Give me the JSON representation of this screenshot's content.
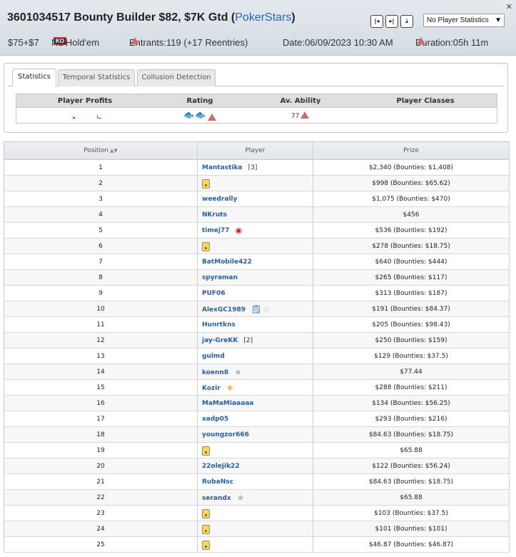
{
  "header": {
    "title_main": "3601034517 Bounty Builder $82, $7K Gtd (",
    "site": "PokerStars",
    "title_end": ")",
    "close": "✕",
    "nav": [
      "|◂",
      "▸|",
      "⤓"
    ],
    "stats_select": "No Player Statistics",
    "buyin": "$75+$7",
    "game": "NL Hold'em",
    "game_badge": "KO",
    "entrants": "Entrants:119 (+17 Reentries)",
    "date": "Date:06/09/2023 10:30 AM",
    "duration": "Duration:05h 11m"
  },
  "tabs": [
    "Statistics",
    "Temporal Statistics",
    "Collusion Detection"
  ],
  "stats": {
    "headers": [
      "Player Profits",
      "Rating",
      "Av. Ability",
      "Player Classes"
    ],
    "av_ability": "77",
    "colors": {
      "loss": "#dd3333",
      "profit": "#22aa22",
      "warning": "#d46a6a"
    }
  },
  "table": {
    "headers": [
      "Position",
      "Player",
      "Prize"
    ],
    "rows": [
      {
        "pos": "1",
        "player": "Mantastika",
        "extra": "[3]",
        "icon": "",
        "prize": "$2,340  (Bounties: $1,408)"
      },
      {
        "pos": "2",
        "player": "",
        "extra": "",
        "icon": "lock-icon",
        "prize": "$998  (Bounties: $65.62)"
      },
      {
        "pos": "3",
        "player": "weedrally",
        "extra": "",
        "icon": "",
        "prize": "$1,075  (Bounties: $470)"
      },
      {
        "pos": "4",
        "player": "NKruts",
        "extra": "",
        "icon": "",
        "prize": "$456"
      },
      {
        "pos": "5",
        "player": "timej77",
        "extra": "",
        "icon": "target-icon",
        "prize": "$536  (Bounties: $192)"
      },
      {
        "pos": "6",
        "player": "",
        "extra": "",
        "icon": "lock-icon",
        "prize": "$278  (Bounties: $18.75)"
      },
      {
        "pos": "7",
        "player": "BatMobile422",
        "extra": "",
        "icon": "",
        "prize": "$640  (Bounties: $444)"
      },
      {
        "pos": "8",
        "player": "spyraman",
        "extra": "",
        "icon": "",
        "prize": "$265  (Bounties: $117)"
      },
      {
        "pos": "9",
        "player": "PUF06",
        "extra": "",
        "icon": "",
        "prize": "$313  (Bounties: $187)"
      },
      {
        "pos": "10",
        "player": "AlexGC1989",
        "extra": "",
        "icon": "note-star-icon",
        "prize": "$191  (Bounties: $84.37)"
      },
      {
        "pos": "11",
        "player": "Hunrtkns",
        "extra": "",
        "icon": "",
        "prize": "$205  (Bounties: $98.43)"
      },
      {
        "pos": "12",
        "player": "jay-GreKK",
        "extra": "[2]",
        "icon": "",
        "prize": "$250  (Bounties: $159)"
      },
      {
        "pos": "13",
        "player": "gulmd",
        "extra": "",
        "icon": "",
        "prize": "$129  (Bounties: $37.5)"
      },
      {
        "pos": "14",
        "player": "koenn8",
        "extra": "",
        "icon": "star-grey-icon",
        "prize": "$77.44"
      },
      {
        "pos": "15",
        "player": "Kozir",
        "extra": "",
        "icon": "star-gold-icon",
        "prize": "$288  (Bounties: $211)"
      },
      {
        "pos": "16",
        "player": "MaMaMiaaaaa",
        "extra": "",
        "icon": "",
        "prize": "$134  (Bounties: $56.25)"
      },
      {
        "pos": "17",
        "player": "xadp05",
        "extra": "",
        "icon": "",
        "prize": "$293  (Bounties: $216)"
      },
      {
        "pos": "18",
        "player": "youngzor666",
        "extra": "",
        "icon": "",
        "prize": "$84.63  (Bounties: $18.75)"
      },
      {
        "pos": "19",
        "player": "",
        "extra": "",
        "icon": "lock-icon",
        "prize": "$65.88"
      },
      {
        "pos": "20",
        "player": "22olejik22",
        "extra": "",
        "icon": "",
        "prize": "$122  (Bounties: $56.24)"
      },
      {
        "pos": "21",
        "player": "RubaNsc",
        "extra": "",
        "icon": "",
        "prize": "$84.63  (Bounties: $18.75)"
      },
      {
        "pos": "22",
        "player": "serandx",
        "extra": "",
        "icon": "star-grey-icon",
        "prize": "$65.88"
      },
      {
        "pos": "23",
        "player": "",
        "extra": "",
        "icon": "lock-icon",
        "prize": "$103  (Bounties: $37.5)"
      },
      {
        "pos": "24",
        "player": "",
        "extra": "",
        "icon": "lock-icon",
        "prize": "$101  (Bounties: $101)"
      },
      {
        "pos": "25",
        "player": "",
        "extra": "",
        "icon": "lock-icon",
        "prize": "$46.87  (Bounties: $46.87)"
      }
    ]
  }
}
